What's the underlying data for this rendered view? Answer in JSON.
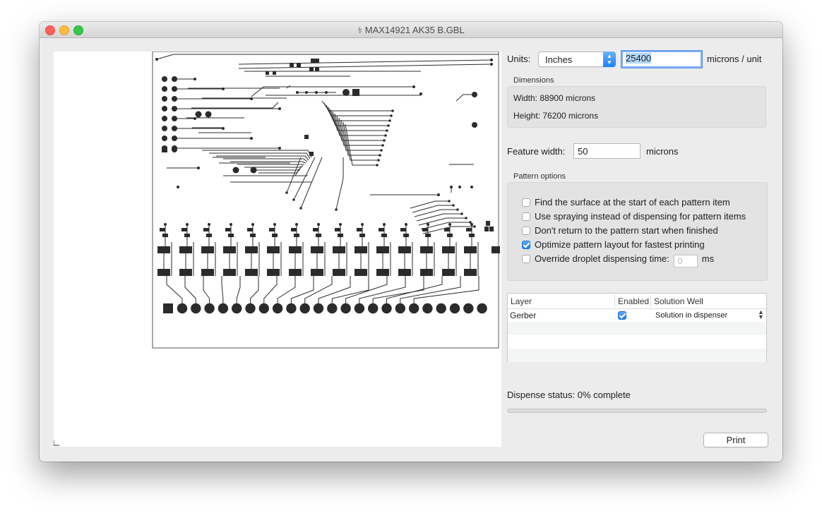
{
  "window": {
    "title": "MAX14921 AK35 B.GBL",
    "icon": "document-icon"
  },
  "units": {
    "label": "Units:",
    "selected": "Inches",
    "microns_per_unit": "25400",
    "suffix": "microns / unit"
  },
  "dimensions": {
    "title": "Dimensions",
    "width_text": "Width: 88900 microns",
    "height_text": "Height: 76200 microns"
  },
  "feature": {
    "label": "Feature width:",
    "value": "50",
    "suffix": "microns"
  },
  "pattern_options": {
    "title": "Pattern options",
    "items": [
      {
        "label": "Find the surface at the start of each pattern item",
        "checked": false
      },
      {
        "label": "Use spraying instead of dispensing for pattern items",
        "checked": false
      },
      {
        "label": "Don't return to the pattern start when finished",
        "checked": false
      },
      {
        "label": "Optimize pattern layout for fastest printing",
        "checked": true
      },
      {
        "label": "Override droplet dispensing time:",
        "checked": false
      }
    ],
    "droplet_time_placeholder": "0",
    "droplet_time_unit": "ms"
  },
  "layers_table": {
    "columns": [
      "Layer",
      "Enabled",
      "Solution Well"
    ],
    "rows": [
      {
        "layer": "Gerber",
        "enabled": true,
        "solution_well": "Solution in dispenser"
      }
    ]
  },
  "status": {
    "text": "Dispense status: 0% complete",
    "progress": 0
  },
  "print_button": {
    "label": "Print"
  },
  "colors": {
    "accent": "#1a82fb",
    "trace": "#2b2b2b",
    "background": "#ececec"
  }
}
